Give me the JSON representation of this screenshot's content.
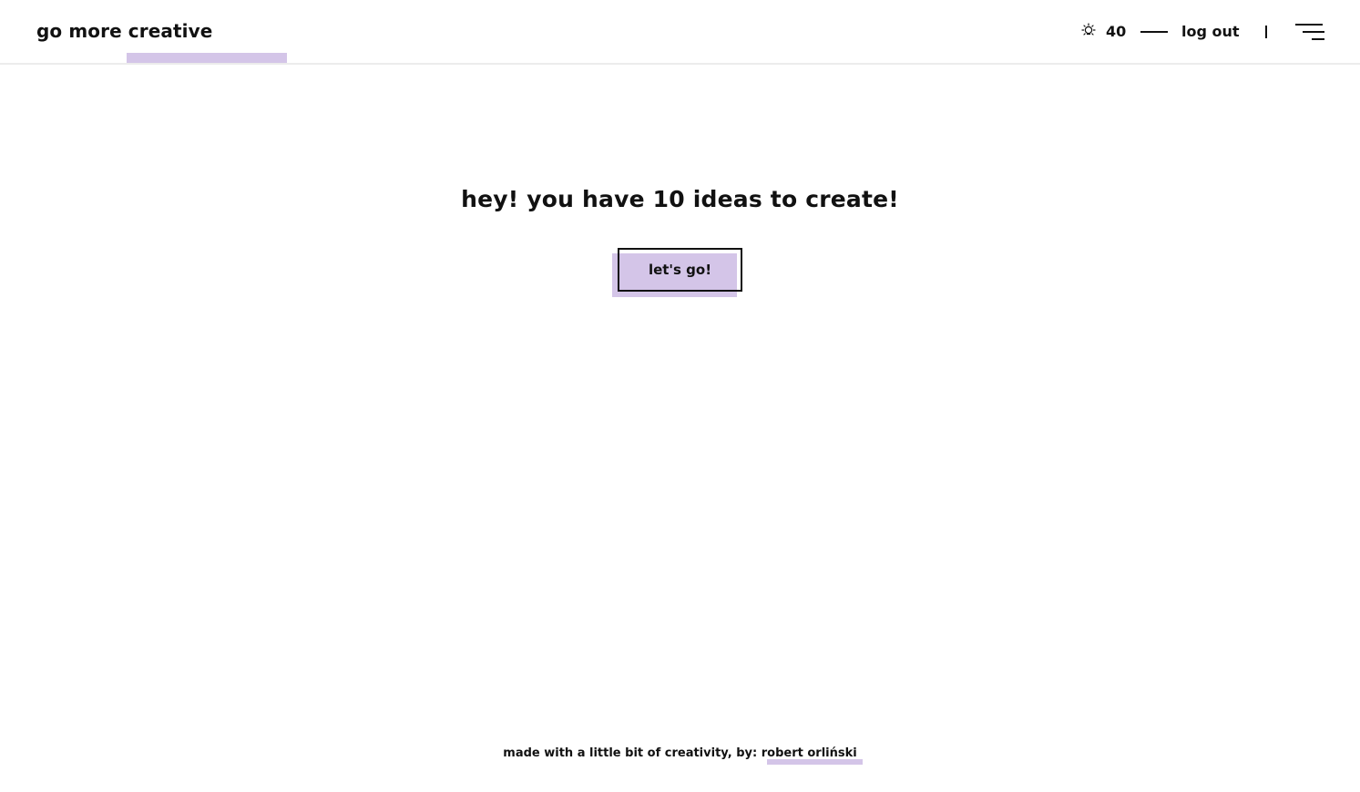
{
  "header": {
    "logo_text": "go more creative",
    "points_value": "40",
    "points_icon": "lightbulb-icon",
    "logout_label": "log out",
    "menu_icon": "hamburger-menu-icon"
  },
  "main": {
    "title": "hey! you have 10 ideas to create!",
    "cta_label": "let's go!"
  },
  "footer": {
    "prefix_text": "made with a little bit of creativity, by:",
    "author_name": "robert orliński"
  },
  "colors": {
    "accent_highlight": "#d4c5e8",
    "text": "#111111",
    "background": "#ffffff"
  }
}
